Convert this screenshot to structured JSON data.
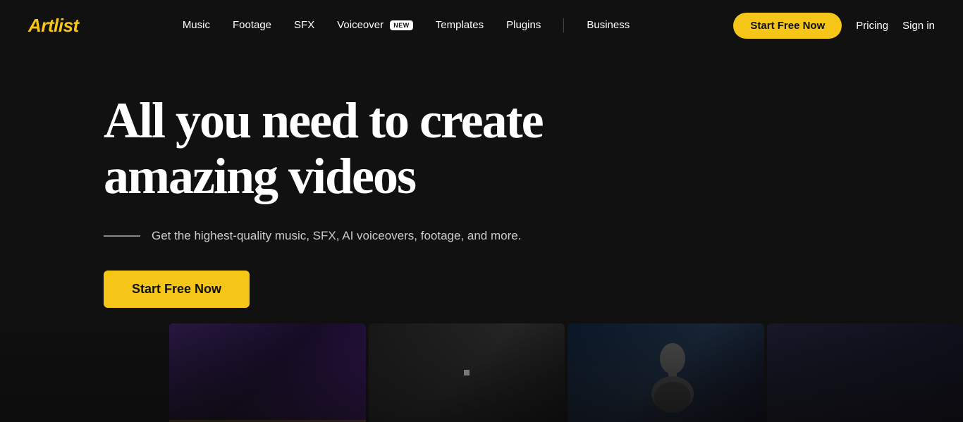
{
  "logo": {
    "text": "Artlist"
  },
  "nav": {
    "links": [
      {
        "id": "music",
        "label": "Music",
        "badge": null
      },
      {
        "id": "footage",
        "label": "Footage",
        "badge": null
      },
      {
        "id": "sfx",
        "label": "SFX",
        "badge": null
      },
      {
        "id": "voiceover",
        "label": "Voiceover",
        "badge": "NEW"
      },
      {
        "id": "templates",
        "label": "Templates",
        "badge": null
      },
      {
        "id": "plugins",
        "label": "Plugins",
        "badge": null
      },
      {
        "id": "business",
        "label": "Business",
        "badge": null
      }
    ],
    "cta_label": "Start Free Now",
    "pricing_label": "Pricing",
    "signin_label": "Sign in"
  },
  "hero": {
    "title_line1": "All you need to create",
    "title_line2": "amazing videos",
    "subtitle": "Get the highest-quality music, SFX, AI voiceovers, footage, and more.",
    "cta_label": "Start Free Now"
  },
  "colors": {
    "accent": "#f5c518",
    "background": "#111111",
    "text_primary": "#ffffff",
    "text_secondary": "#cccccc"
  }
}
